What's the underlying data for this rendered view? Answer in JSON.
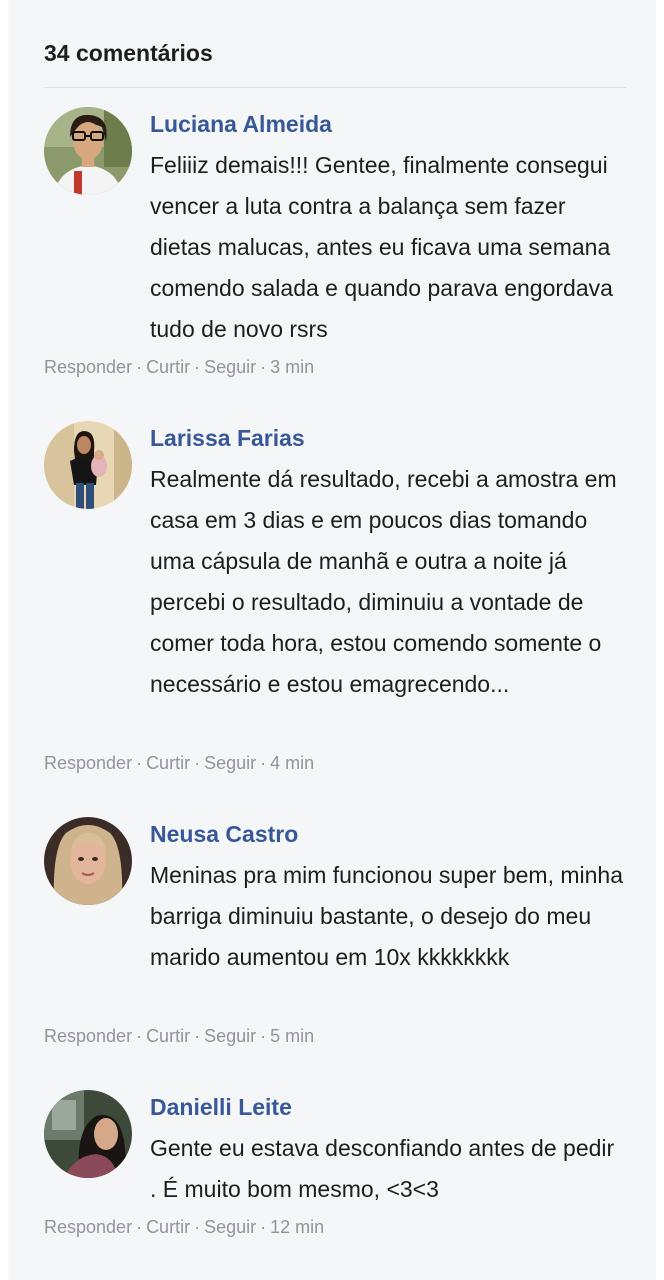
{
  "header": {
    "comment_count": "34 comentários"
  },
  "actions": {
    "reply": "Responder",
    "like": "Curtir",
    "follow": "Seguir",
    "separator": "·"
  },
  "comments": [
    {
      "author": "Luciana Almeida",
      "text": "Feliiiz demais!!! Gentee, finalmente consegui vencer a luta contra a balança sem fazer dietas malucas, antes eu ficava uma semana comendo salada e quando parava engordava tudo de novo rsrs",
      "time": "3 min"
    },
    {
      "author": "Larissa Farias",
      "text": "Realmente dá resultado, recebi a amostra em casa em 3 dias e em poucos dias tomando uma cápsula de manhã e outra a noite já percebi o resultado, diminuiu a vontade de comer toda hora, estou comendo somente o necessário e estou emagrecendo...",
      "time": "4 min"
    },
    {
      "author": "Neusa Castro",
      "text": "Meninas pra mim funcionou super bem, minha barriga diminuiu bastante, o desejo do meu marido aumentou em 10x kkkkkkkk",
      "time": "5 min"
    },
    {
      "author": "Danielli Leite",
      "text": "Gente eu estava desconfiando antes de pedir . É muito bom mesmo, <3<3",
      "time": "12 min"
    }
  ]
}
